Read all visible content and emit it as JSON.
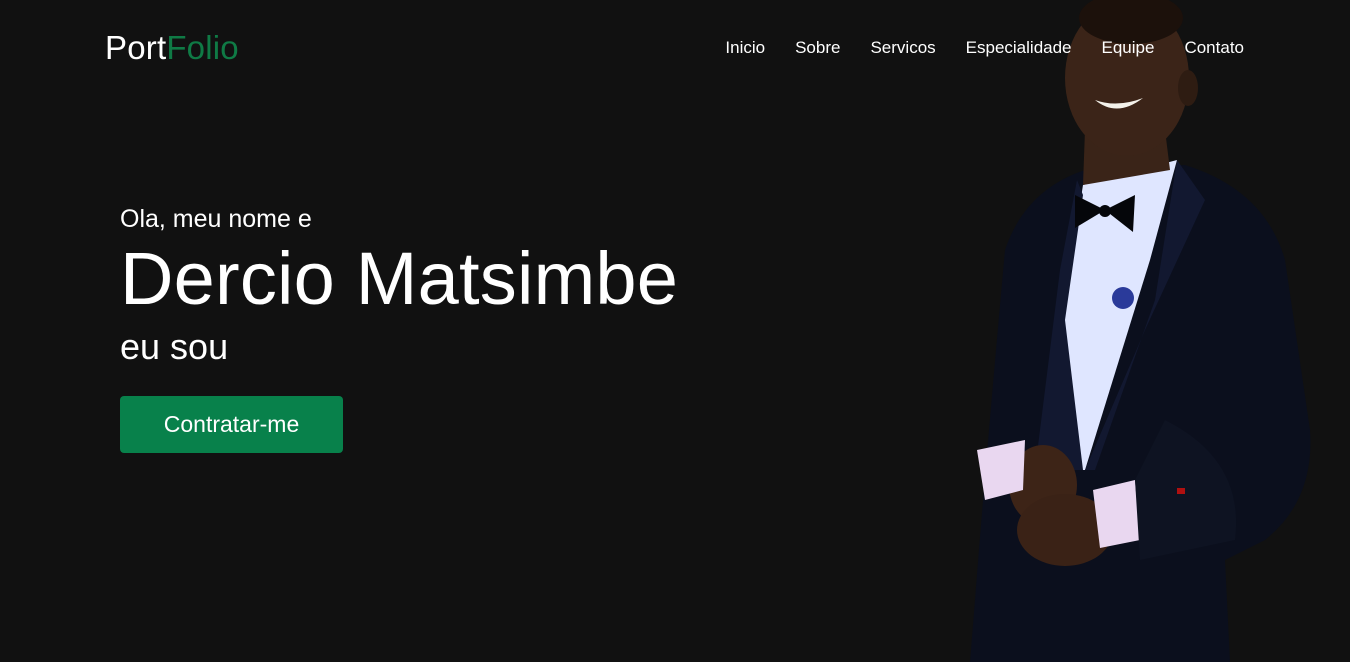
{
  "logo": {
    "part1": "Port",
    "part2": "Folio"
  },
  "nav": {
    "items": [
      "Inicio",
      "Sobre",
      "Servicos",
      "Especialidade",
      "Equipe",
      "Contato"
    ]
  },
  "hero": {
    "greeting": "Ola, meu nome e",
    "name": "Dercio Matsimbe",
    "role": "eu sou",
    "cta_label": "Contratar-me"
  },
  "colors": {
    "background": "#111111",
    "accent": "#0f7a45",
    "button": "#08814b",
    "text": "#ffffff"
  },
  "portrait": {
    "icon": "person-in-suit-photo"
  }
}
